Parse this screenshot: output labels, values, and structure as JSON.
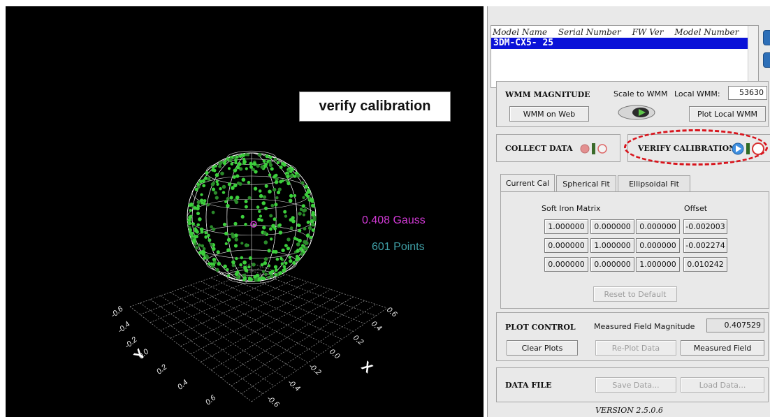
{
  "viewport": {
    "overlay_label": "verify calibration",
    "gauss_readout": "0.408 Gauss",
    "points_readout": "601 Points",
    "axis_x_letter": "X",
    "axis_y_letter": "Y",
    "y_ticks": [
      "-0.6",
      "-0.4",
      "-0.2",
      "0.0",
      "0.2",
      "0.4",
      "0.6"
    ],
    "x_ticks": [
      "0.6",
      "0.4",
      "0.2",
      "0.0",
      "-0.2",
      "-0.4",
      "-0.6"
    ],
    "colors": {
      "background": "#000000",
      "points": "#3ccf3c",
      "sphere_mesh": "#ffffff",
      "center_marker": "#d23ad6"
    }
  },
  "device_list": {
    "columns": [
      "Model Name",
      "Serial Number",
      "FW Ver",
      "Model Number"
    ],
    "selected_row": "3DM-CX5- 25"
  },
  "wmm": {
    "title": "WMM MAGNITUDE",
    "scale_label": "Scale to WMM",
    "local_label": "Local WMM:",
    "local_value": "53630",
    "web_button": "WMM on Web",
    "plot_button": "Plot Local WMM"
  },
  "collect": {
    "title": "COLLECT DATA"
  },
  "verify": {
    "title": "VERIFY CALIBRATION"
  },
  "tabs": [
    {
      "label": "Current Cal"
    },
    {
      "label": "Spherical Fit"
    },
    {
      "label": "Ellipsoidal Fit"
    }
  ],
  "calibration": {
    "soft_iron_label": "Soft Iron Matrix",
    "offset_label": "Offset",
    "matrix": [
      [
        "1.000000",
        "0.000000",
        "0.000000"
      ],
      [
        "0.000000",
        "1.000000",
        "0.000000"
      ],
      [
        "0.000000",
        "0.000000",
        "1.000000"
      ]
    ],
    "offset": [
      "-0.002003",
      "-0.002274",
      "0.010242"
    ],
    "reset_button": "Reset to Default"
  },
  "plot_control": {
    "title": "PLOT CONTROL",
    "measured_label": "Measured Field Magnitude",
    "measured_value": "0.407529",
    "clear_button": "Clear Plots",
    "replot_button": "Re-Plot Data",
    "measured_button": "Measured Field"
  },
  "data_file": {
    "title": "DATA FILE",
    "save_button": "Save Data...",
    "load_button": "Load Data..."
  },
  "version": "VERSION  2.5.0.6"
}
